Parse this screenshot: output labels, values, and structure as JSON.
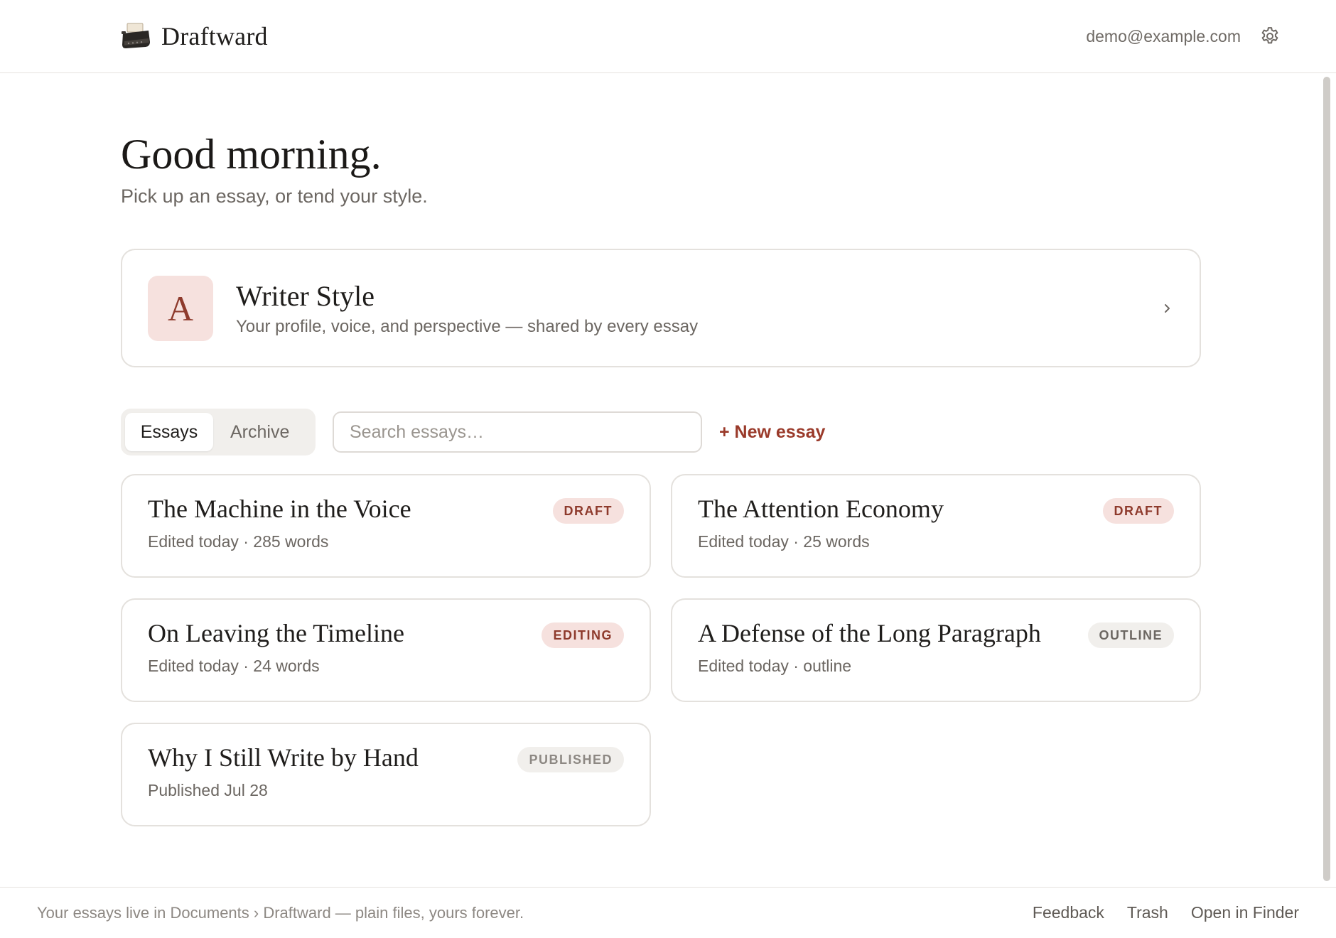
{
  "header": {
    "app_name": "Draftward",
    "logo_icon": "typewriter-icon",
    "account_email": "demo@example.com",
    "settings_icon": "gear-icon"
  },
  "greeting": {
    "title": "Good morning.",
    "subtitle": "Pick up an essay, or tend your style."
  },
  "style_card": {
    "avatar_letter": "A",
    "title": "Writer Style",
    "description": "Your profile, voice, and perspective — shared by every essay"
  },
  "toolbar": {
    "tabs": [
      {
        "label": "Essays",
        "active": true
      },
      {
        "label": "Archive",
        "active": false
      }
    ],
    "search_placeholder": "Search essays…",
    "new_essay_label": "+ New essay"
  },
  "essays": [
    {
      "title": "The Machine in the Voice",
      "meta": "Edited today · 285 words",
      "status": "DRAFT"
    },
    {
      "title": "The Attention Economy",
      "meta": "Edited today · 25 words",
      "status": "DRAFT"
    },
    {
      "title": "On Leaving the Timeline",
      "meta": "Edited today · 24 words",
      "status": "EDITING"
    },
    {
      "title": "A Defense of the Long Paragraph",
      "meta": "Edited today · outline",
      "status": "OUTLINE"
    },
    {
      "title": "Why I Still Write by Hand",
      "meta": "Published Jul 28",
      "status": "PUBLISHED"
    }
  ],
  "footer": {
    "note": "Your essays live in Documents › Draftward — plain files, yours forever.",
    "links": [
      "Feedback",
      "Trash",
      "Open in Finder"
    ]
  },
  "colors": {
    "accent": "#9a3a2a",
    "badge_warm_bg": "#f6e1de",
    "badge_neutral_bg": "#f1efec",
    "border": "#e4e1dd"
  }
}
